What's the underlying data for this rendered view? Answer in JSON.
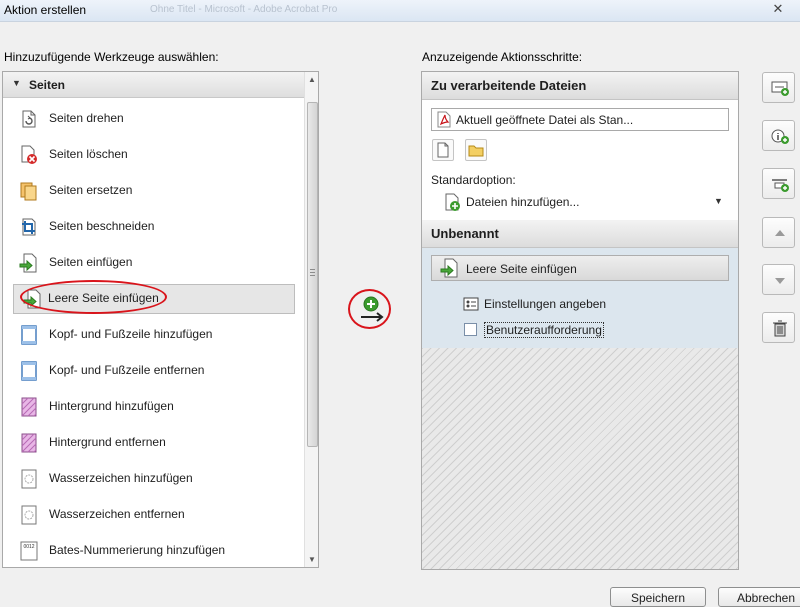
{
  "window": {
    "title": "Aktion erstellen",
    "title_ghost": "Ohne Titel - Microsoft - Adobe Acrobat Pro"
  },
  "left": {
    "heading": "Hinzuzufügende Werkzeuge auswählen:",
    "group_label": "Seiten",
    "items": [
      {
        "label": "Seiten drehen",
        "icon": "rotate-pages-icon"
      },
      {
        "label": "Seiten löschen",
        "icon": "delete-pages-icon"
      },
      {
        "label": "Seiten ersetzen",
        "icon": "replace-pages-icon"
      },
      {
        "label": "Seiten beschneiden",
        "icon": "crop-pages-icon"
      },
      {
        "label": "Seiten einfügen",
        "icon": "insert-pages-icon"
      },
      {
        "label": "Leere Seite einfügen",
        "icon": "insert-blank-page-icon"
      },
      {
        "label": "Kopf- und Fußzeile hinzufügen",
        "icon": "header-footer-add-icon"
      },
      {
        "label": "Kopf- und Fußzeile entfernen",
        "icon": "header-footer-remove-icon"
      },
      {
        "label": "Hintergrund hinzufügen",
        "icon": "background-add-icon"
      },
      {
        "label": "Hintergrund entfernen",
        "icon": "background-remove-icon"
      },
      {
        "label": "Wasserzeichen hinzufügen",
        "icon": "watermark-add-icon"
      },
      {
        "label": "Wasserzeichen entfernen",
        "icon": "watermark-remove-icon"
      },
      {
        "label": "Bates-Nummerierung hinzufügen",
        "icon": "bates-numbering-icon",
        "icon_text": "0012"
      }
    ],
    "selected_index": 5
  },
  "right": {
    "heading": "Anzuzeigende Aktionsschritte:",
    "files_header": "Zu verarbeitende Dateien",
    "file_field": "Aktuell geöffnete Datei als Stan...",
    "standard_label": "Standardoption:",
    "standard_value": "Dateien hinzufügen...",
    "unnamed_header": "Unbenannt",
    "step_label": "Leere Seite einfügen",
    "sub_settings": "Einstellungen angeben",
    "sub_prompt": "Benutzeraufforderung",
    "prompt_checked": false
  },
  "side_buttons": [
    "add-file-icon",
    "add-info-icon",
    "add-separator-icon",
    "move-up-icon",
    "move-down-icon",
    "trash-icon"
  ],
  "footer": {
    "save": "Speichern",
    "cancel": "Abbrechen"
  },
  "colors": {
    "highlight_ellipse": "#d9141b",
    "steps_background": "#dce6ee",
    "accent_green": "#3b9b2e"
  }
}
